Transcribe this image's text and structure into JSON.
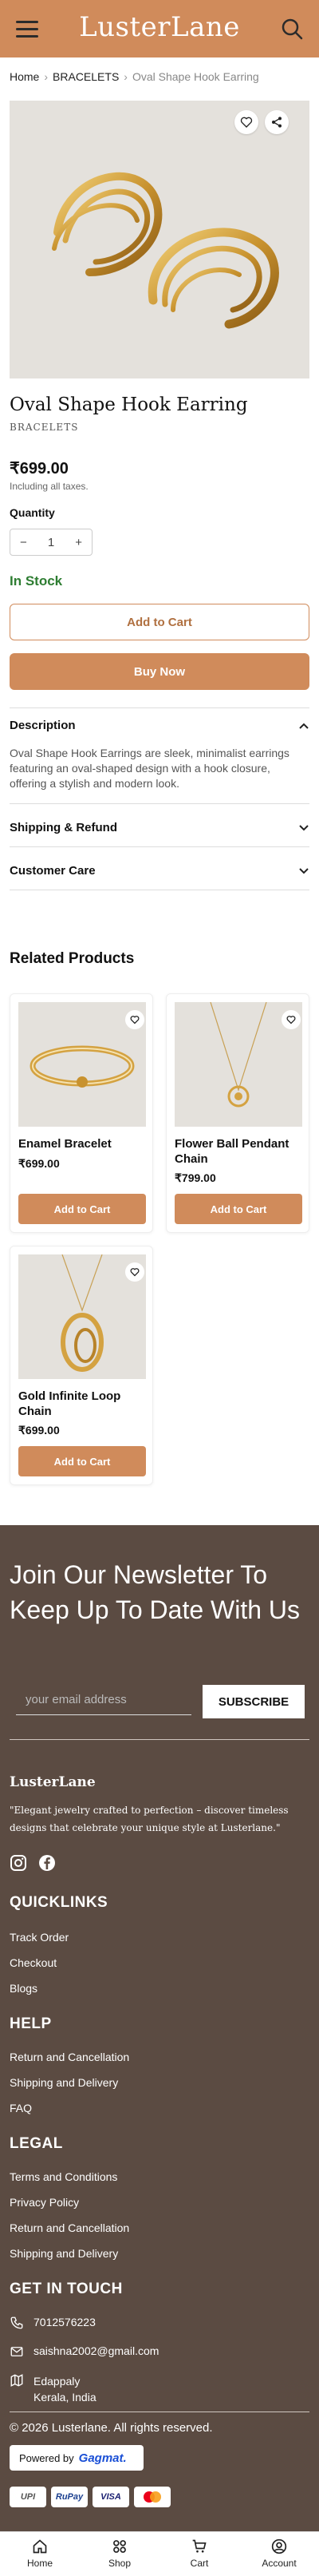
{
  "header": {
    "brand": "LusterLane"
  },
  "breadcrumb": {
    "home": "Home",
    "category": "BRACELETS",
    "current": "Oval Shape Hook Earring"
  },
  "product": {
    "title": "Oval Shape Hook Earring",
    "category": "BRACELETS",
    "price": "₹699.00",
    "taxes": "Including all taxes.",
    "quantity_label": "Quantity",
    "quantity": "1",
    "stock": "In Stock",
    "add_to_cart": "Add to Cart",
    "buy_now": "Buy Now"
  },
  "accordion": {
    "description_title": "Description",
    "description_text": "Oval Shape Hook Earrings are sleek, minimalist earrings featuring an oval-shaped design with a hook closure, offering a stylish and modern look.",
    "shipping_title": "Shipping & Refund",
    "care_title": "Customer Care"
  },
  "related": {
    "heading": "Related Products",
    "items": [
      {
        "name": "Enamel Bracelet",
        "price": "₹699.00",
        "button": "Add to Cart"
      },
      {
        "name": "Flower Ball Pendant Chain",
        "price": "₹799.00",
        "button": "Add to Cart"
      },
      {
        "name": "Gold Infinite Loop Chain",
        "price": "₹699.00",
        "button": "Add to Cart"
      }
    ]
  },
  "footer": {
    "newsletter_title": "Join Our Newsletter To Keep Up To Date With Us",
    "email_placeholder": "your email address",
    "subscribe": "SUBSCRIBE",
    "brand": "LusterLane",
    "tagline": "\"Elegant jewelry crafted to perfection – discover timeless designs that celebrate your unique style at Lusterlane.\"",
    "quicklinks_title": "QUICKLINKS",
    "quicklinks": [
      "Track Order",
      "Checkout",
      "Blogs"
    ],
    "help_title": "HELP",
    "help": [
      "Return and Cancellation",
      "Shipping and Delivery",
      "FAQ"
    ],
    "legal_title": "LEGAL",
    "legal": [
      "Terms and Conditions",
      "Privacy Policy",
      "Return and Cancellation",
      "Shipping and Delivery"
    ],
    "contact_title": "GET IN TOUCH",
    "phone": "7012576223",
    "email": "saishna2002@gmail.com",
    "address_line1": "Edappaly",
    "address_line2": "Kerala, India",
    "copyright": "© 2026 Lusterlane. All rights reserved.",
    "powered_by": "Powered by",
    "powered_brand": "Gagmat.",
    "payments": [
      "UPI",
      "RuPay",
      "VISA",
      "Mastercard"
    ]
  },
  "bottom_nav": [
    "Home",
    "Shop",
    "Cart",
    "Account"
  ],
  "colors": {
    "accent": "#d08b5b",
    "footer_bg": "#5b4b42",
    "in_stock": "#2e7d32"
  }
}
